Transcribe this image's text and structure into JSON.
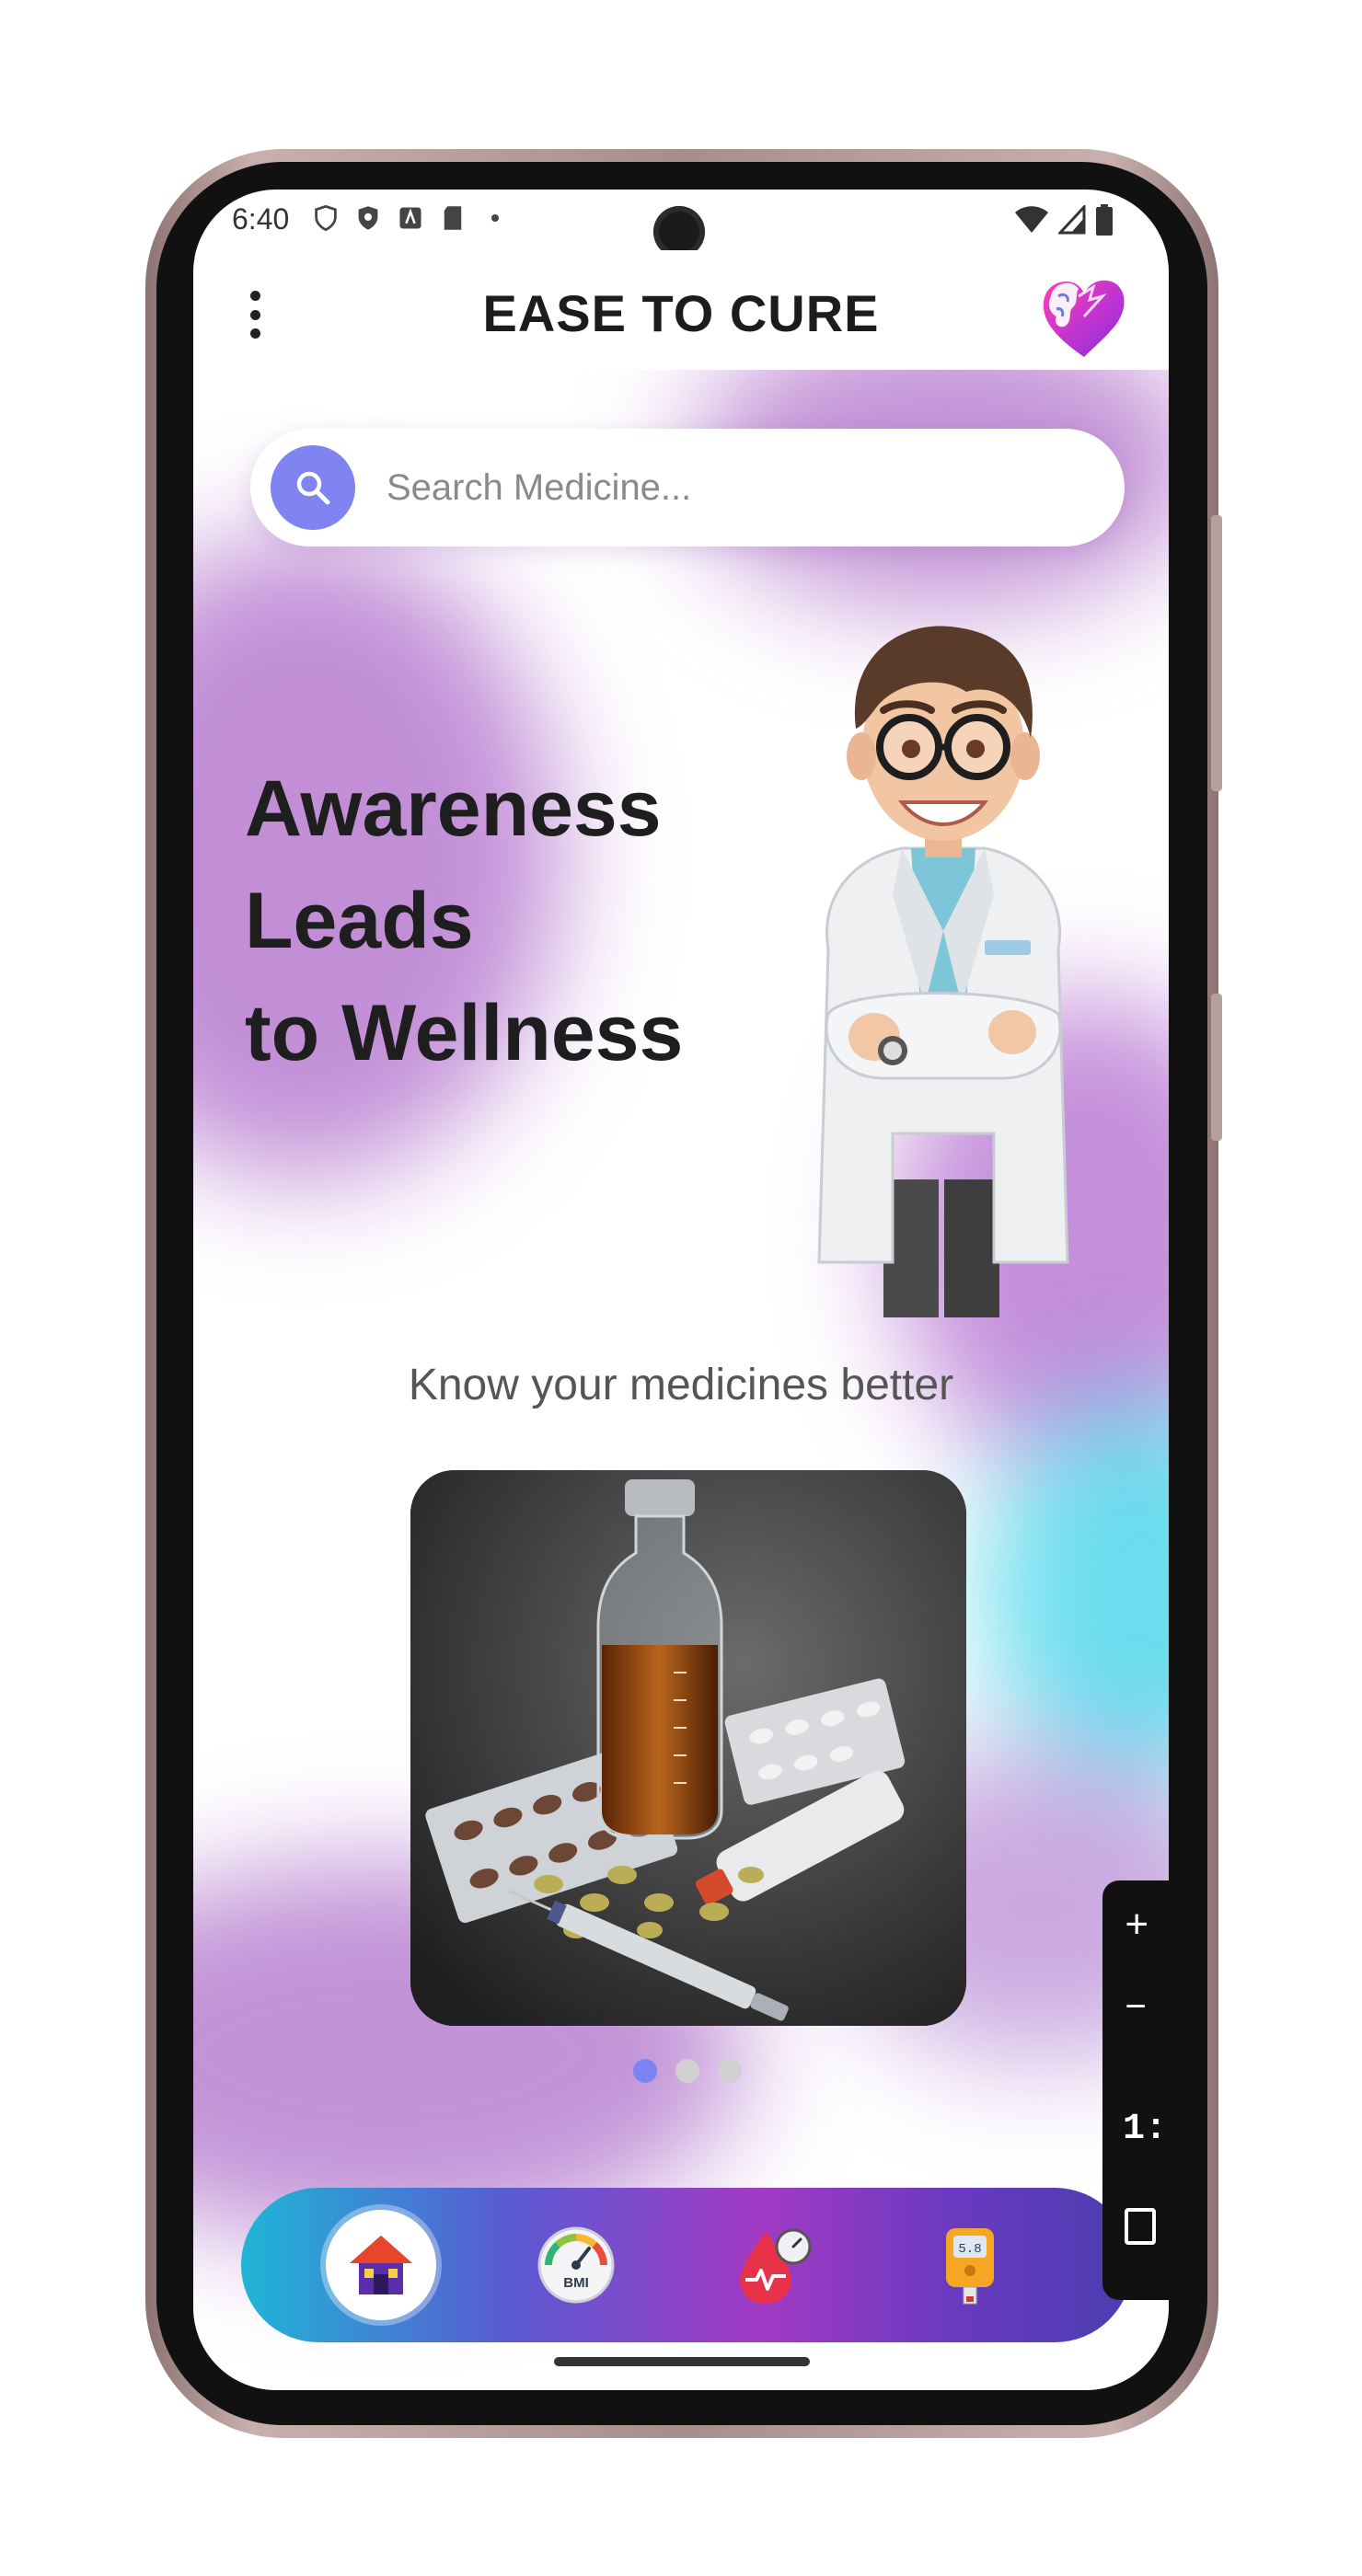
{
  "status_bar": {
    "time": "6:40"
  },
  "app_bar": {
    "title": "EASE TO CURE"
  },
  "search": {
    "placeholder": "Search Medicine..."
  },
  "hero": {
    "line1": "Awareness",
    "line2": "Leads",
    "line3": "to Wellness"
  },
  "section": {
    "subtitle": "Know your medicines better"
  },
  "carousel": {
    "total_pages": 3,
    "active_page": 1
  },
  "bottom_nav": {
    "items": [
      "home-icon",
      "bmi-gauge-icon",
      "blood-pressure-icon",
      "glucometer-icon"
    ],
    "active_item": "home-icon",
    "bmi_label": "BMI",
    "glucometer_reading": "5.8"
  },
  "overlay_tab": {
    "text": "1:"
  },
  "colors": {
    "accent": "#7b84f2",
    "title": "#1c1c1c",
    "nav_gradient_start": "#1fb5d6",
    "nav_gradient_mid": "#a23ac4",
    "nav_gradient_end": "#4a3eb0"
  }
}
